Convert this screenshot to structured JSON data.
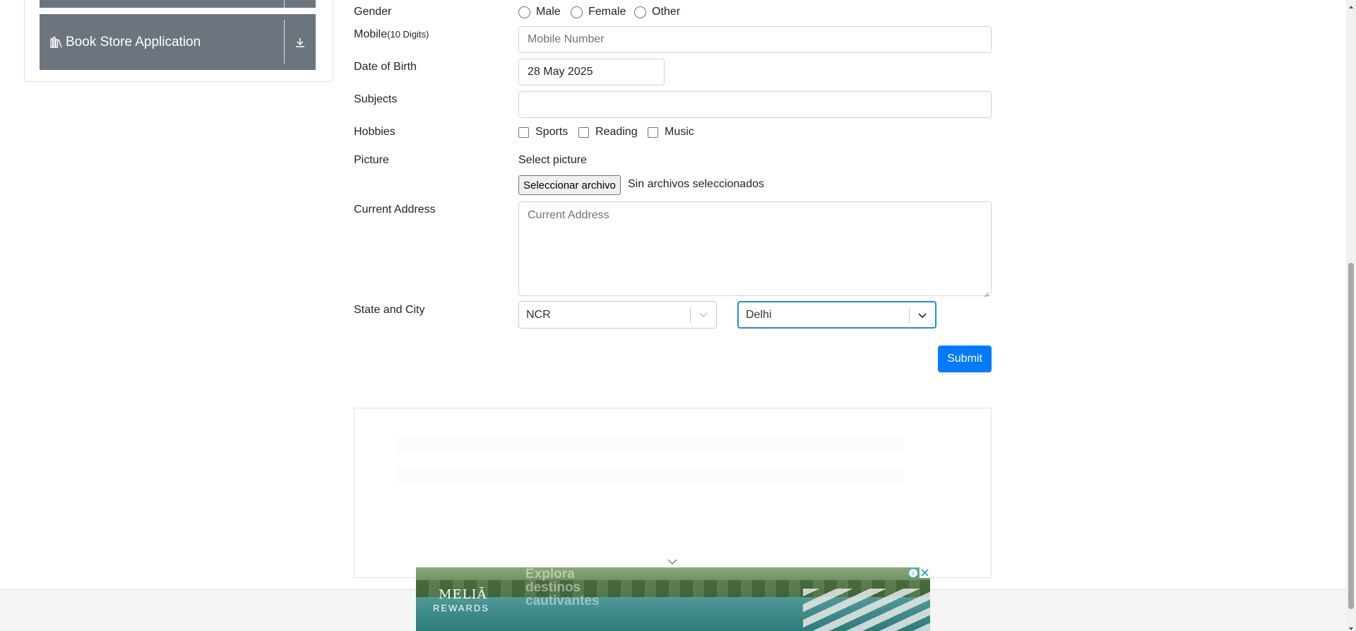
{
  "sidebar": {
    "book_store": {
      "label": "Book Store Application",
      "icon": "books-icon",
      "action_icon": "download-icon"
    }
  },
  "form": {
    "gender": {
      "label": "Gender",
      "options": [
        "Male",
        "Female",
        "Other"
      ]
    },
    "mobile": {
      "label": "Mobile",
      "hint": "(10 Digits)",
      "placeholder": "Mobile Number"
    },
    "dob": {
      "label": "Date of Birth",
      "value": "28 May 2025"
    },
    "subjects": {
      "label": "Subjects",
      "value": ""
    },
    "hobbies": {
      "label": "Hobbies",
      "options": [
        "Sports",
        "Reading",
        "Music"
      ]
    },
    "picture": {
      "label": "Picture",
      "caption": "Select picture",
      "button": "Seleccionar archivo",
      "status": "Sin archivos seleccionados"
    },
    "address": {
      "label": "Current Address",
      "placeholder": "Current Address"
    },
    "state_city": {
      "label": "State and City",
      "state": "NCR",
      "city": "Delhi"
    },
    "submit": "Submit"
  },
  "ad": {
    "brand_line1": "MELIĀ",
    "brand_line2": "REWARDS",
    "tagline": "Explora destinos cautivantes",
    "info": "i",
    "close": "✕"
  },
  "colors": {
    "primary": "#007bff",
    "sidebar_item": "#6c757d",
    "focus": "#2684ff"
  }
}
